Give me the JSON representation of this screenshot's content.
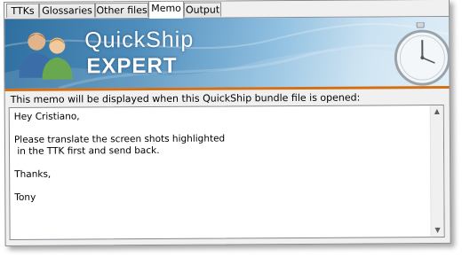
{
  "tabs": [
    {
      "label": "TTKs",
      "active": false
    },
    {
      "label": "Glossaries",
      "active": false
    },
    {
      "label": "Other files",
      "active": false
    },
    {
      "label": "Memo",
      "active": true
    },
    {
      "label": "Output",
      "active": false
    }
  ],
  "banner": {
    "title": "QuickShip",
    "subtitle": "EXPERT",
    "accent_color": "#d36f14"
  },
  "memo": {
    "label": "This memo will be displayed when this QuickShip bundle file is opened:",
    "text": "Hey Cristiano,\n\nPlease translate the screen shots highlighted\n in the TTK first and send back.\n\nThanks,\n\nTony"
  },
  "icons": {
    "banner_people": "users-icon",
    "banner_stopwatch": "stopwatch-icon",
    "scroll_up": "scroll-up-arrow-icon",
    "scroll_down": "scroll-down-arrow-icon"
  }
}
